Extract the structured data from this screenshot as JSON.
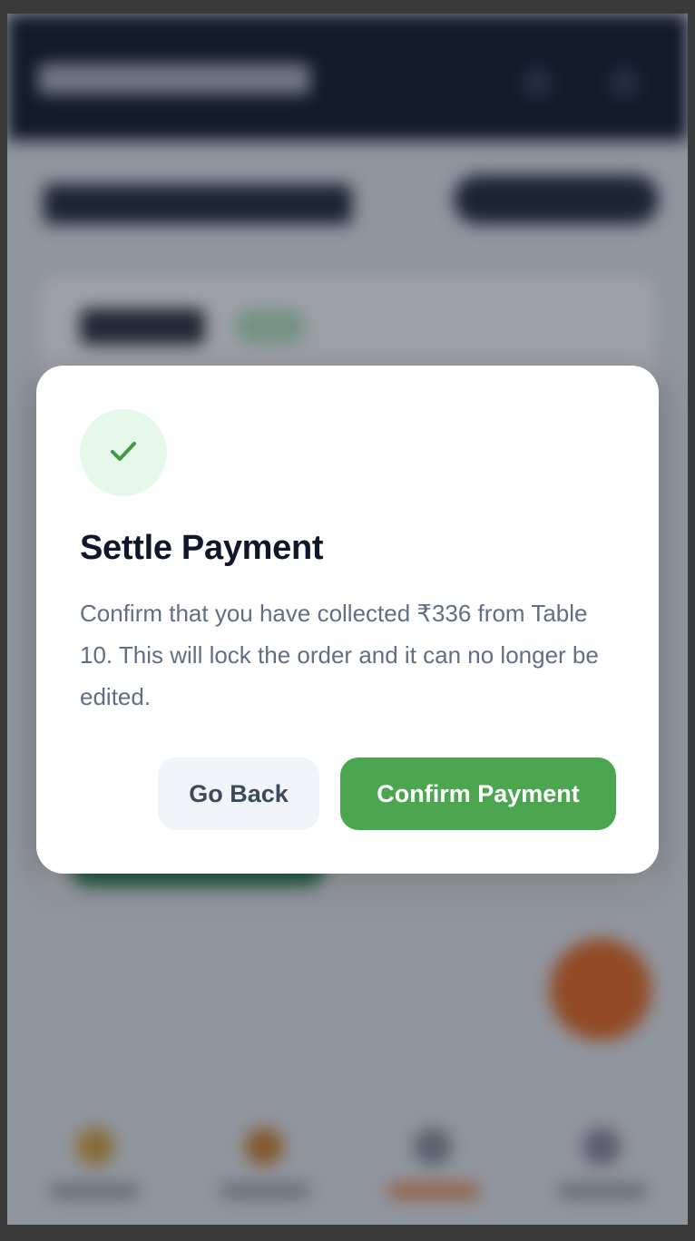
{
  "modal": {
    "title": "Settle Payment",
    "message": "Confirm that you have collected ₹336 from Table 10. This will lock the order and it can no longer be edited.",
    "back_label": "Go Back",
    "confirm_label": "Confirm Payment",
    "icon": "check-icon"
  },
  "colors": {
    "accent_green": "#4ba64f",
    "badge_bg": "#e6f8ea",
    "title": "#0f172a",
    "text": "#5f6f86"
  }
}
